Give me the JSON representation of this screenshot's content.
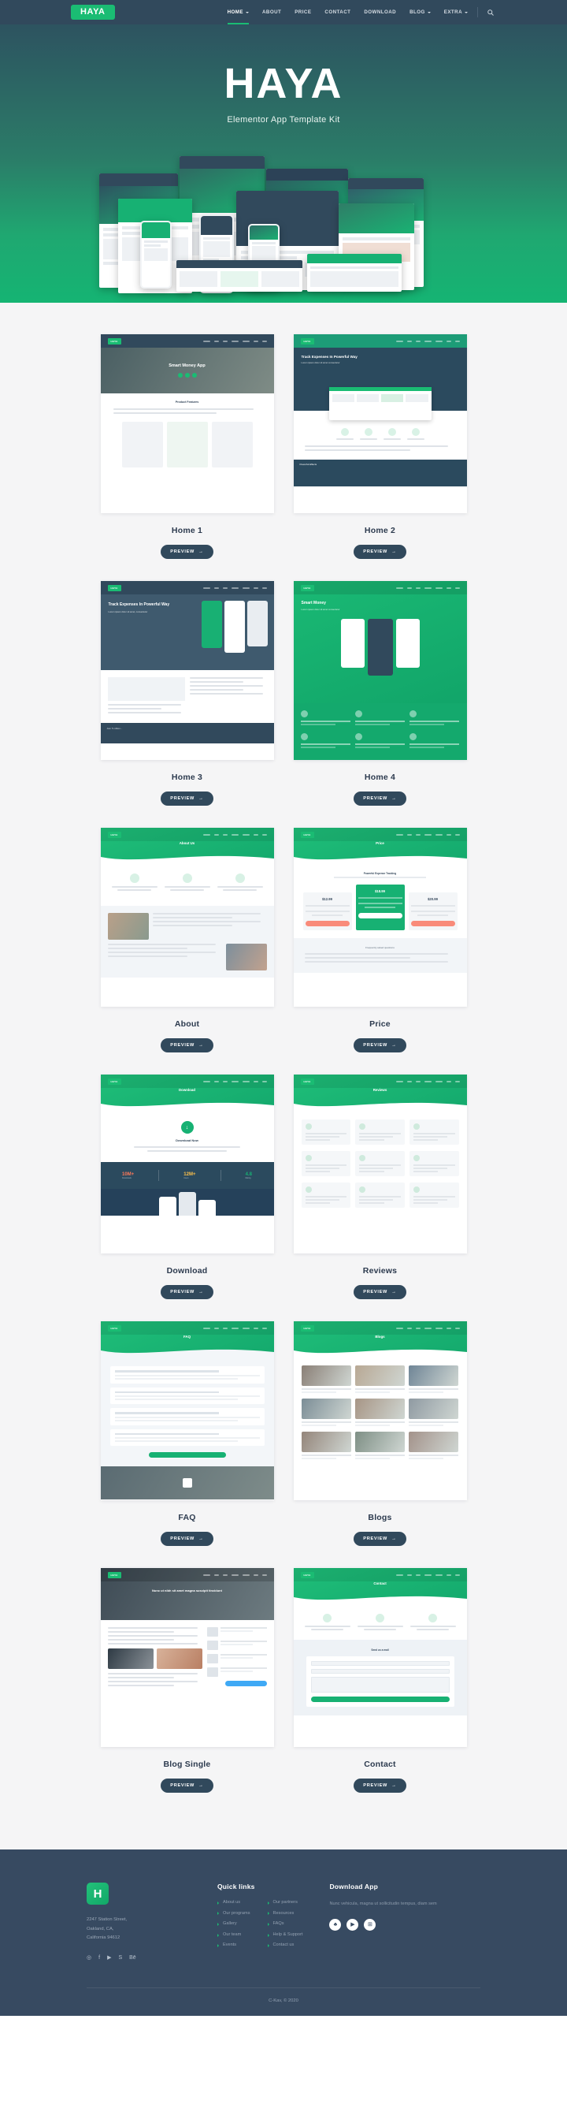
{
  "nav": {
    "logo": "HAYA",
    "items": [
      {
        "label": "HOME",
        "has_dropdown": true,
        "active": true
      },
      {
        "label": "ABOUT",
        "has_dropdown": false,
        "active": false
      },
      {
        "label": "PRICE",
        "has_dropdown": false,
        "active": false
      },
      {
        "label": "CONTACT",
        "has_dropdown": false,
        "active": false
      },
      {
        "label": "DOWNLOAD",
        "has_dropdown": false,
        "active": false
      },
      {
        "label": "BLOG",
        "has_dropdown": true,
        "active": false
      },
      {
        "label": "EXTRA",
        "has_dropdown": true,
        "active": false
      }
    ],
    "search_icon": "search-icon"
  },
  "hero": {
    "title": "HAYA",
    "subtitle": "Elementor App Template Kit"
  },
  "gallery": {
    "preview_label": "PREVIEW",
    "preview_arrow": "→",
    "cards": [
      {
        "title": "Home 1",
        "kind": "home1"
      },
      {
        "title": "Home 2",
        "kind": "home2"
      },
      {
        "title": "Home 3",
        "kind": "home3"
      },
      {
        "title": "Home 4",
        "kind": "home4"
      },
      {
        "title": "About",
        "kind": "about"
      },
      {
        "title": "Price",
        "kind": "price"
      },
      {
        "title": "Download",
        "kind": "download"
      },
      {
        "title": "Reviews",
        "kind": "reviews"
      },
      {
        "title": "FAQ",
        "kind": "faq"
      },
      {
        "title": "Blogs",
        "kind": "blogs"
      },
      {
        "title": "Blog Single",
        "kind": "blogsingle"
      },
      {
        "title": "Contact",
        "kind": "contact"
      }
    ],
    "mock_text": {
      "home1_headline": "Smart Money App",
      "home1_section": "Product Features",
      "home2_headline": "Track Expenses In Powerful Way",
      "home3_headline": "Track Expenses In Powerful Way",
      "home4_headline": "Smart Money",
      "about_headline": "About Us",
      "price_headline": "Price",
      "price_tiers": [
        "$12.99",
        "$18.99",
        "$20.99"
      ],
      "download_headline": "Download",
      "download_cta": "Download Now",
      "download_stats": [
        "10M+",
        "12M+",
        "4.8"
      ],
      "reviews_headline": "Reviews",
      "faq_headline": "FAQ",
      "blogs_headline": "Blogs",
      "blogsingle_headline": "Nunc ut nibh sit amet magna suscipit tincidunt",
      "contact_headline": "Contact"
    }
  },
  "footer": {
    "logo_letter": "H",
    "address": "2247 Station Street,\nOakland, CA,\nCalifornia 94612",
    "social_icons": [
      "instagram-icon",
      "facebook-icon",
      "youtube-icon",
      "skype-icon",
      "behance-icon"
    ],
    "social_glyphs": [
      "◎",
      "f",
      "▶",
      "S",
      "Bē"
    ],
    "quick_links_heading": "Quick links",
    "quick_links_col1": [
      "About us",
      "Our programs",
      "Gallery",
      "Our team",
      "Events"
    ],
    "quick_links_col2": [
      "Our partners",
      "Resources",
      "FAQs",
      "Help & Support",
      "Contact us"
    ],
    "download_heading": "Download App",
    "download_desc": "Nunc vehicula, magna ut sollicitudin tempus, diam sem",
    "store_icons": [
      "apple-store-icon",
      "google-play-icon",
      "windows-store-icon"
    ],
    "store_glyphs": [
      "♣",
      "▶",
      "⊞"
    ],
    "copyright": "C-Kav, © 2020"
  },
  "colors": {
    "brand_green": "#1abc73",
    "nav_dark": "#31495c",
    "footer_dark": "#374a61",
    "page_bg": "#f5f5f6"
  }
}
